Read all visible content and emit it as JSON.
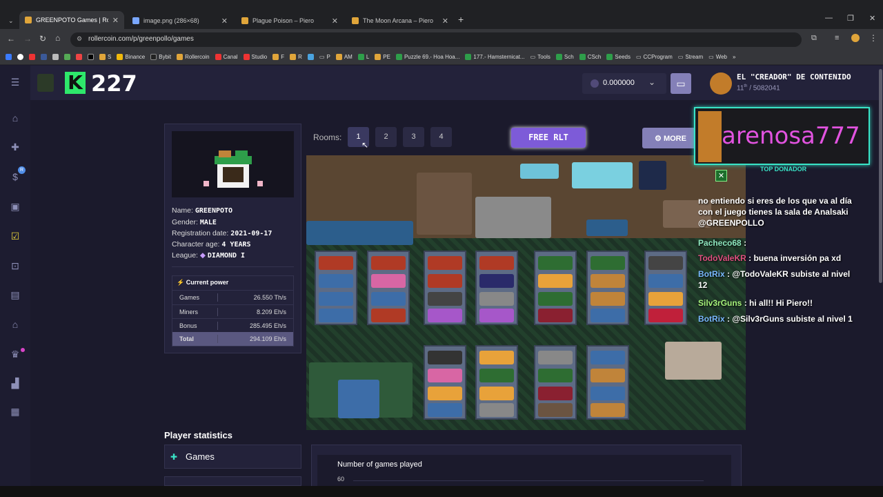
{
  "browser": {
    "tabs": [
      {
        "title": "GREENPOTO Games | Rollercoin"
      },
      {
        "title": "image.png (286×68)"
      },
      {
        "title": "Plague Poison – Piero"
      },
      {
        "title": "The Moon Arcana – Piero"
      }
    ],
    "url": "rollercoin.com/p/greenpollo/games",
    "bookmarks": [
      "S",
      "Binance",
      "Bybit",
      "Rollercoin",
      "Canal",
      "Studio",
      "F",
      "R",
      "P",
      "AM",
      "L",
      "PE",
      "Puzzle 69.- Hoa Hoa...",
      "177.- Hamsternicat...",
      "Tools",
      "Sch",
      "CSch",
      "Seeds",
      "CCProgram",
      "Stream",
      "Web"
    ]
  },
  "header": {
    "level": "227",
    "level_letter": "K",
    "balance": "0.000000",
    "user_title": "EL \"CREADOR\" DE CONTENIDO",
    "rank": "11",
    "rank_suffix": "th",
    "rank_total": "/ 5082041"
  },
  "profile": {
    "name_label": "Name:",
    "name": "GREENPOTO",
    "gender_label": "Gender:",
    "gender": "MALE",
    "registration_label": "Registration date:",
    "registration": "2021-09-17",
    "age_label": "Character age:",
    "age": "4 YEARS",
    "league_label": "League:",
    "league": "DIAMOND I"
  },
  "power": {
    "title": "Current power",
    "rows": [
      {
        "name": "Games",
        "value": "26.550 Th/s"
      },
      {
        "name": "Miners",
        "value": "8.209 Eh/s"
      },
      {
        "name": "Bonus",
        "value": "285.495 Eh/s"
      },
      {
        "name": "Total",
        "value": "294.109 Eh/s"
      }
    ]
  },
  "rooms": {
    "label": "Rooms:",
    "buttons": [
      "1",
      "2",
      "3",
      "4"
    ],
    "selected": "1",
    "free_rlt": "FREE RLT",
    "more": "MORE"
  },
  "stream_overlay": {
    "streamer": "arenosa777",
    "badge": "TOP DONADOR",
    "messages": [
      {
        "user": "",
        "text": "no entiendo si eres de los que va al día con el juego tienes la sala de Analsaki @GREENPOLLO"
      },
      {
        "user": "Pacheco68",
        "text": ":"
      },
      {
        "user": "TodoValeKR",
        "text": ": buena inversión pa xd"
      },
      {
        "user": "BotRix",
        "text": ": @TodoValeKR subiste al nivel 12"
      },
      {
        "user": "Silv3rGuns",
        "text": ": hi all!! Hi Piero!!"
      },
      {
        "user": "BotRix",
        "text": ": @Silv3rGuns subiste al nivel 1"
      }
    ]
  },
  "stats": {
    "title": "Player statistics",
    "games_tab": "Games",
    "chart_title": "Number of games played",
    "y_tick": "60"
  },
  "colors": {
    "accent_green": "#2ee86b",
    "purple": "#7d5bd8",
    "teal": "#39e4c7"
  }
}
